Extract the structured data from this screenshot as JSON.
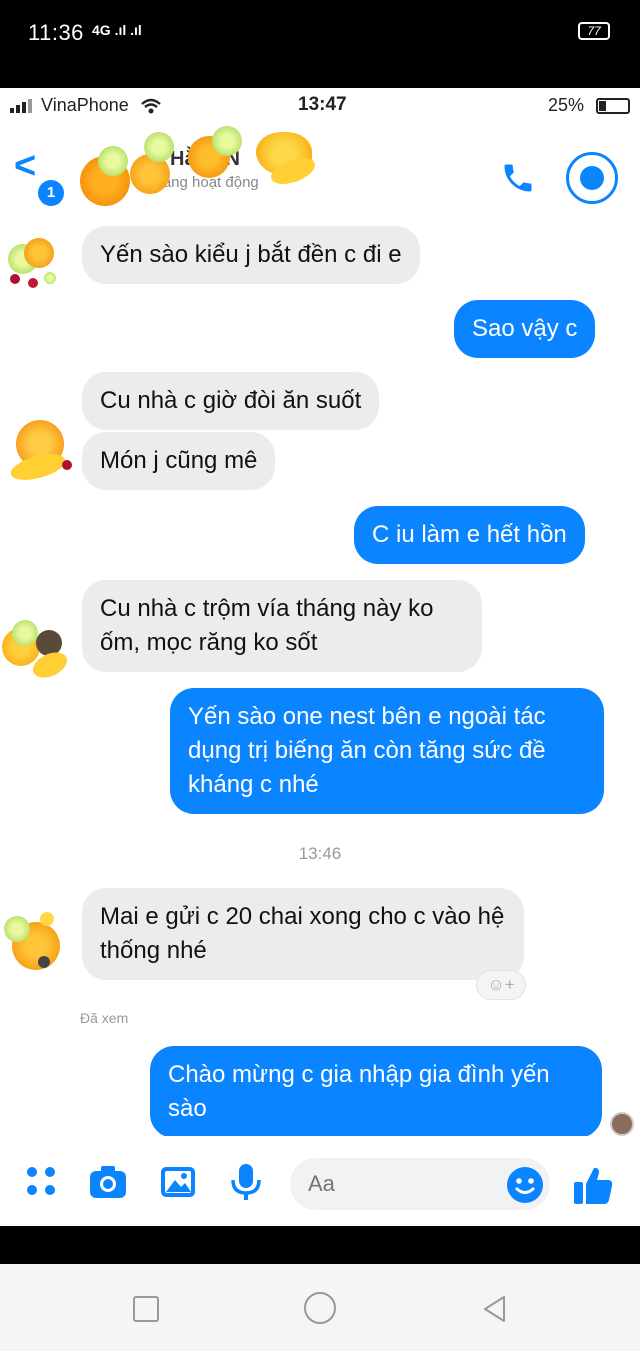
{
  "outer_status": {
    "time": "11:36",
    "signal": "4G .ıl .ıl",
    "battery": "77"
  },
  "inner_status": {
    "carrier": "VinaPhone",
    "time": "13:47",
    "battery": "25%"
  },
  "header": {
    "back_badge": "1",
    "contact_name": "Hằng N",
    "contact_status": "Đang hoạt động"
  },
  "messages": [
    {
      "side": "received",
      "text": "Yến sào kiểu j bắt đền c đi e"
    },
    {
      "side": "sent",
      "text": "Sao vậy c"
    },
    {
      "side": "received",
      "text": "Cu nhà c giờ đòi ăn suốt"
    },
    {
      "side": "received",
      "text": "Món j cũng mê"
    },
    {
      "side": "sent",
      "text": "C iu làm e hết hồn"
    },
    {
      "side": "received",
      "text": "Cu nhà c trộm vía tháng này ko ốm, mọc răng ko sốt"
    },
    {
      "side": "sent",
      "text": "Yến sào one nest bên e ngoài tác dụng trị biếng ăn còn tăng sức đề kháng c nhé"
    },
    {
      "side": "received",
      "text": "Mai e gửi c 20 chai xong cho c vào hệ thống nhé"
    },
    {
      "side": "sent",
      "text": "Chào mừng c gia nhập gia đình yến sào"
    }
  ],
  "timestamp": "13:46",
  "seen_label": "Đã xem",
  "react_label": "☺+",
  "composer": {
    "placeholder": "Aa"
  },
  "colors": {
    "accent": "#0a84ff",
    "received_bubble": "#ececec"
  },
  "icons": [
    "grid-icon",
    "camera-icon",
    "image-icon",
    "microphone-icon",
    "emoji-icon",
    "thumbs-up-icon",
    "phone-icon",
    "video-icon",
    "back-chevron-icon"
  ]
}
